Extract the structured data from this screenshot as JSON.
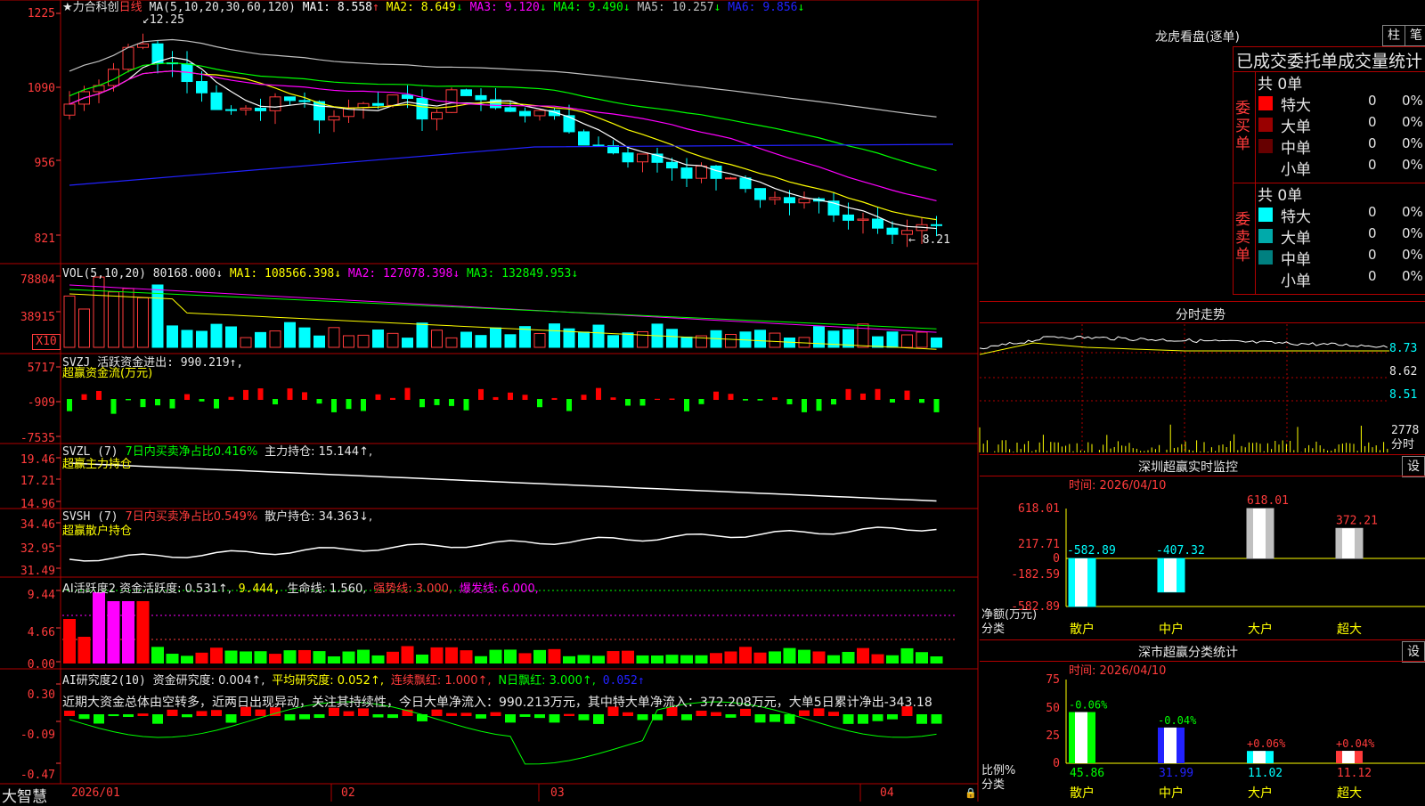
{
  "main": {
    "stock_name": "★力合科创",
    "period": "日线",
    "ma_label": "MA(5,10,20,30,60,120)",
    "ma_values": [
      {
        "label": "MA1: 8.558",
        "arrow": "↑",
        "color": "#ffffff"
      },
      {
        "label": "MA2: 8.649",
        "arrow": "↓",
        "color": "#ffff00"
      },
      {
        "label": "MA3: 9.120",
        "arrow": "↓",
        "color": "#ff00ff"
      },
      {
        "label": "MA4: 9.490",
        "arrow": "↓",
        "color": "#00ff00"
      },
      {
        "label": "MA5: 10.257",
        "arrow": "↓",
        "color": "#c0c0c0"
      },
      {
        "label": "MA6: 9.856",
        "arrow": "↓",
        "color": "#2222ff"
      }
    ],
    "y_ticks": [
      "1225",
      "1090",
      "956",
      "821"
    ],
    "high_mark": "12.25",
    "low_mark": "← 8.21"
  },
  "vol": {
    "label": "VOL(5,10,20)",
    "value": "80168.000↓",
    "ma1": "MA1: 108566.398↓",
    "ma2": "MA2: 127078.398↓",
    "ma3": "MA3: 132849.953↓",
    "y_ticks": [
      "78804",
      "38915"
    ],
    "unit": "X10"
  },
  "svzj": {
    "label": "SVZJ  活跃资金进出: 990.219↑,",
    "sub": "超赢资金流(万元)",
    "y_ticks": [
      "5717",
      "-909",
      "-7535"
    ]
  },
  "svzl": {
    "label": "SVZL (7)",
    "green": "7日内买卖净占比0.416%",
    "rest": "主力持仓: 15.144↑,",
    "sub": "超赢主力持仓",
    "y_ticks": [
      "19.46",
      "17.21",
      "14.96"
    ]
  },
  "svsh": {
    "label": "SVSH (7)",
    "red": "7日内买卖净占比0.549%",
    "rest": "散户持仓: 34.363↓,",
    "sub": "超赢散户持仓",
    "y_ticks": [
      "34.46",
      "32.95",
      "31.49"
    ]
  },
  "ai1": {
    "label": "AI活跃度2 资金活跃度: 0.531↑,",
    "v2": "9.444,",
    "life": "生命线: 1.560,",
    "strong": "强势线: 3.000,",
    "burst": "爆发线: 6.000,",
    "y_ticks": [
      "9.44",
      "4.66",
      "0.00"
    ]
  },
  "ai2": {
    "label": "AI研究度2(10)",
    "f1": "资金研究度: 0.004↑,",
    "f2": "平均研究度: 0.052↑,",
    "f3": "连续飘红: 1.000↑,",
    "f4": "N日飘红: 3.000↑,",
    "f5": "0.052↑",
    "comment": "近期大资金总体由空转多，近两日出现异动，关注其持续性，今日大单净流入：990.213万元，其中特大单净流入：372.208万元，大单5日累计净出-343.18",
    "y_ticks": [
      "0.30",
      "-0.09",
      "-0.47"
    ]
  },
  "xaxis": {
    "app": "大智慧",
    "labels": [
      "2026/01",
      "02",
      "03",
      "04"
    ]
  },
  "right": {
    "dragon_title": "龙虎看盘(逐单)",
    "btn1": "柱",
    "btn2": "笔",
    "stat_header": "已成交委托单成交量统计",
    "buy_side": "委买单",
    "sell_side": "委卖单",
    "buy_total": "共 0单",
    "sell_total": "共 0单",
    "rows": [
      {
        "name": "特大",
        "count": "0",
        "pct": "0%"
      },
      {
        "name": "大单",
        "count": "0",
        "pct": "0%"
      },
      {
        "name": "中单",
        "count": "0",
        "pct": "0%"
      },
      {
        "name": "小单",
        "count": "0",
        "pct": "0%"
      }
    ],
    "buy_colors": [
      "#ff0000",
      "#990000",
      "#660000"
    ],
    "sell_colors": [
      "#00ffff",
      "#00aaaa",
      "#008080"
    ],
    "intraday_title": "分时走势",
    "intraday_ticks": [
      "8.73",
      "8.62",
      "8.51"
    ],
    "intraday_vol": "2778",
    "intraday_unit": "分时",
    "monitor_title": "深圳超赢实时监控",
    "monitor_btn": "设",
    "monitor_date": "时间: 2026/04/10",
    "monitor_ticks": [
      "618.01",
      "217.71",
      "0",
      "-182.59",
      "-582.89"
    ],
    "monitor_ylabel": "净额(万元)",
    "monitor_xlabel": "分类",
    "monitor_cats": [
      "散户",
      "中户",
      "大户",
      "超大"
    ],
    "monitor_values": [
      "-582.89",
      "-407.32",
      "618.01",
      "372.21"
    ],
    "class_title": "深市超赢分类统计",
    "class_btn": "设",
    "class_date": "时间: 2026/04/10",
    "class_ticks": [
      "75",
      "50",
      "25",
      "0"
    ],
    "class_ylabel": "比例%",
    "class_xlabel": "分类",
    "class_cats": [
      "散户",
      "中户",
      "大户",
      "超大"
    ],
    "class_values": [
      "45.86",
      "31.99",
      "11.02",
      "11.12"
    ],
    "class_changes": [
      "-0.06%",
      "-0.04%",
      "+0.06%",
      "+0.04%"
    ]
  }
}
